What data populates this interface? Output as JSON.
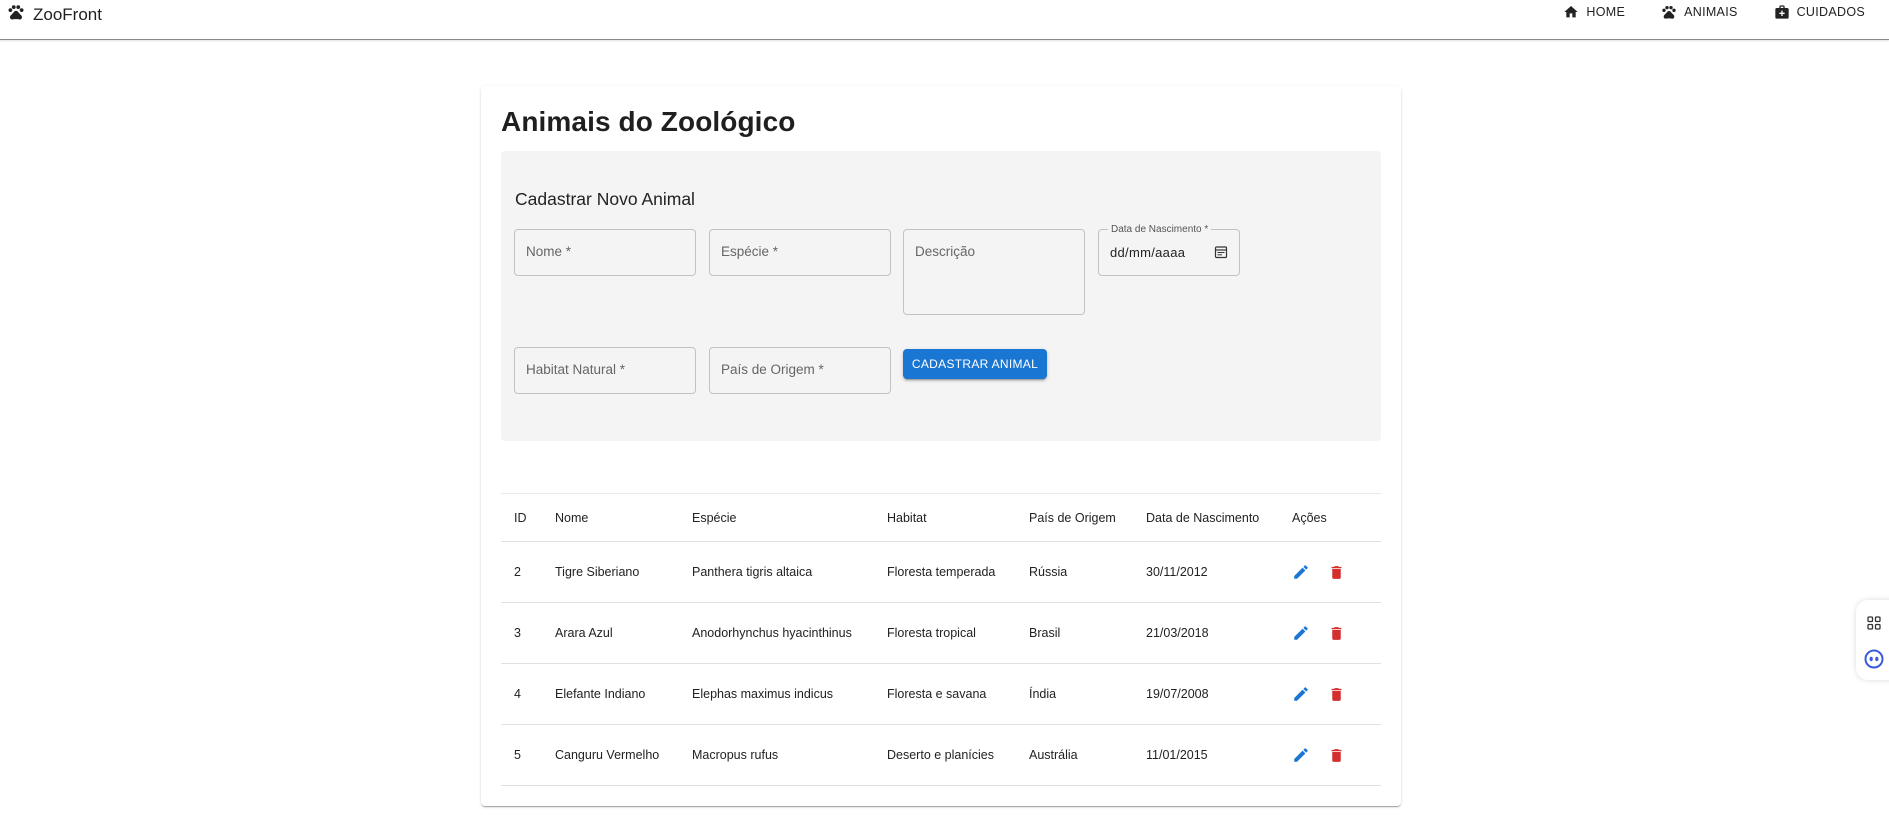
{
  "app": {
    "title": "ZooFront"
  },
  "nav": [
    {
      "label": "HOME",
      "icon": "home-icon"
    },
    {
      "label": "ANIMAIS",
      "icon": "paw-icon"
    },
    {
      "label": "CUIDADOS",
      "icon": "medical-bag-icon"
    }
  ],
  "page": {
    "title": "Animais do Zoológico"
  },
  "form": {
    "title": "Cadastrar Novo Animal",
    "fields": {
      "nome": "Nome *",
      "especie": "Espécie *",
      "descricao": "Descrição",
      "data_nascimento_label": "Data de Nascimento *",
      "data_nascimento_placeholder": "dd/mm/aaaa",
      "habitat": "Habitat Natural *",
      "pais": "País de Origem *"
    },
    "submit_label": "CADASTRAR ANIMAL"
  },
  "table": {
    "columns": [
      "ID",
      "Nome",
      "Espécie",
      "Habitat",
      "País de Origem",
      "Data de Nascimento",
      "Ações"
    ],
    "rows": [
      [
        "2",
        "Tigre Siberiano",
        "Panthera tigris altaica",
        "Floresta temperada",
        "Rússia",
        "30/11/2012"
      ],
      [
        "3",
        "Arara Azul",
        "Anodorhynchus hyacinthinus",
        "Floresta tropical",
        "Brasil",
        "21/03/2018"
      ],
      [
        "4",
        "Elefante Indiano",
        "Elephas maximus indicus",
        "Floresta e savana",
        "Índia",
        "19/07/2008"
      ],
      [
        "5",
        "Canguru Vermelho",
        "Macropus rufus",
        "Deserto e planícies",
        "Austrália",
        "11/01/2015"
      ]
    ]
  },
  "colors": {
    "primary": "#1976d2",
    "delete": "#d32f2f",
    "form_background": "#f4f4f4"
  }
}
